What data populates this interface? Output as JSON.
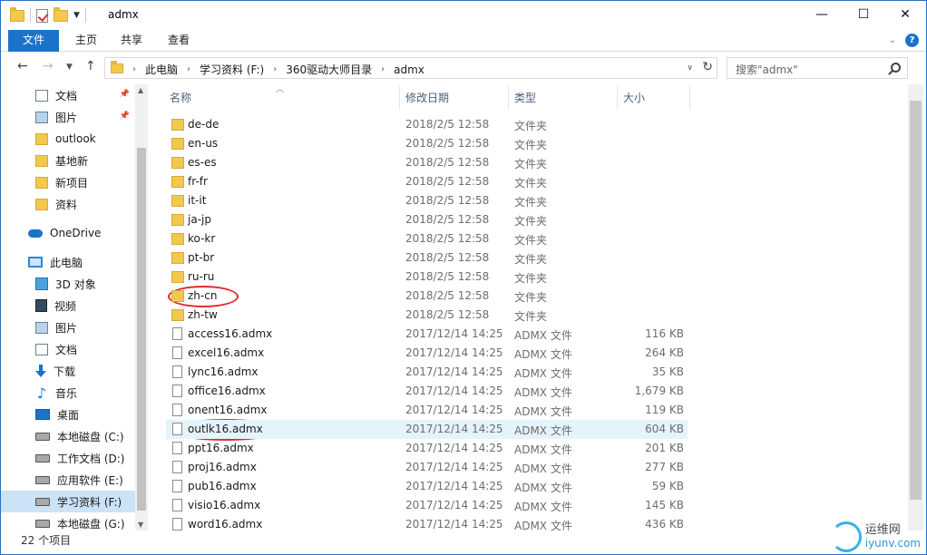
{
  "window": {
    "title": "admx"
  },
  "ribbon": {
    "tabs": [
      "文件",
      "主页",
      "共享",
      "查看"
    ]
  },
  "address": {
    "crumbs": [
      "此电脑",
      "学习资料 (F:)",
      "360驱动大师目录",
      "admx"
    ]
  },
  "search": {
    "placeholder": "搜索\"admx\""
  },
  "navpane": {
    "items": [
      {
        "label": "文档",
        "icon": "document-icon",
        "pinned": true
      },
      {
        "label": "图片",
        "icon": "picture-icon",
        "pinned": true
      },
      {
        "label": "outlook",
        "icon": "folder-icon"
      },
      {
        "label": "基地新",
        "icon": "folder-icon"
      },
      {
        "label": "新项目",
        "icon": "folder-icon"
      },
      {
        "label": "资料",
        "icon": "folder-icon"
      },
      {
        "label": "OneDrive",
        "icon": "onedrive-cloud-icon"
      },
      {
        "label": "此电脑",
        "icon": "this-pc-icon"
      },
      {
        "label": "3D 对象",
        "icon": "3d-objects-icon"
      },
      {
        "label": "视频",
        "icon": "video-icon"
      },
      {
        "label": "图片",
        "icon": "picture-icon"
      },
      {
        "label": "文档",
        "icon": "document-icon"
      },
      {
        "label": "下载",
        "icon": "download-icon"
      },
      {
        "label": "音乐",
        "icon": "music-icon"
      },
      {
        "label": "桌面",
        "icon": "desktop-icon"
      },
      {
        "label": "本地磁盘 (C:)",
        "icon": "drive-icon"
      },
      {
        "label": "工作文档 (D:)",
        "icon": "drive-icon"
      },
      {
        "label": "应用软件 (E:)",
        "icon": "drive-icon"
      },
      {
        "label": "学习资料 (F:)",
        "icon": "drive-icon",
        "selected": true
      },
      {
        "label": "本地磁盘 (G:)",
        "icon": "drive-icon"
      }
    ]
  },
  "columns": {
    "name": "名称",
    "date": "修改日期",
    "type": "类型",
    "size": "大小"
  },
  "files": [
    {
      "name": "de-de",
      "date": "2018/2/5 12:58",
      "type": "文件夹",
      "size": "",
      "kind": "folder"
    },
    {
      "name": "en-us",
      "date": "2018/2/5 12:58",
      "type": "文件夹",
      "size": "",
      "kind": "folder"
    },
    {
      "name": "es-es",
      "date": "2018/2/5 12:58",
      "type": "文件夹",
      "size": "",
      "kind": "folder"
    },
    {
      "name": "fr-fr",
      "date": "2018/2/5 12:58",
      "type": "文件夹",
      "size": "",
      "kind": "folder"
    },
    {
      "name": "it-it",
      "date": "2018/2/5 12:58",
      "type": "文件夹",
      "size": "",
      "kind": "folder"
    },
    {
      "name": "ja-jp",
      "date": "2018/2/5 12:58",
      "type": "文件夹",
      "size": "",
      "kind": "folder"
    },
    {
      "name": "ko-kr",
      "date": "2018/2/5 12:58",
      "type": "文件夹",
      "size": "",
      "kind": "folder"
    },
    {
      "name": "pt-br",
      "date": "2018/2/5 12:58",
      "type": "文件夹",
      "size": "",
      "kind": "folder"
    },
    {
      "name": "ru-ru",
      "date": "2018/2/5 12:58",
      "type": "文件夹",
      "size": "",
      "kind": "folder"
    },
    {
      "name": "zh-cn",
      "date": "2018/2/5 12:58",
      "type": "文件夹",
      "size": "",
      "kind": "folder"
    },
    {
      "name": "zh-tw",
      "date": "2018/2/5 12:58",
      "type": "文件夹",
      "size": "",
      "kind": "folder"
    },
    {
      "name": "access16.admx",
      "date": "2017/12/14 14:25",
      "type": "ADMX 文件",
      "size": "116 KB",
      "kind": "file"
    },
    {
      "name": "excel16.admx",
      "date": "2017/12/14 14:25",
      "type": "ADMX 文件",
      "size": "264 KB",
      "kind": "file"
    },
    {
      "name": "lync16.admx",
      "date": "2017/12/14 14:25",
      "type": "ADMX 文件",
      "size": "35 KB",
      "kind": "file"
    },
    {
      "name": "office16.admx",
      "date": "2017/12/14 14:25",
      "type": "ADMX 文件",
      "size": "1,679 KB",
      "kind": "file"
    },
    {
      "name": "onent16.admx",
      "date": "2017/12/14 14:25",
      "type": "ADMX 文件",
      "size": "119 KB",
      "kind": "file"
    },
    {
      "name": "outlk16.admx",
      "date": "2017/12/14 14:25",
      "type": "ADMX 文件",
      "size": "604 KB",
      "kind": "file",
      "hover": true
    },
    {
      "name": "ppt16.admx",
      "date": "2017/12/14 14:25",
      "type": "ADMX 文件",
      "size": "201 KB",
      "kind": "file"
    },
    {
      "name": "proj16.admx",
      "date": "2017/12/14 14:25",
      "type": "ADMX 文件",
      "size": "277 KB",
      "kind": "file"
    },
    {
      "name": "pub16.admx",
      "date": "2017/12/14 14:25",
      "type": "ADMX 文件",
      "size": "59 KB",
      "kind": "file"
    },
    {
      "name": "visio16.admx",
      "date": "2017/12/14 14:25",
      "type": "ADMX 文件",
      "size": "145 KB",
      "kind": "file"
    },
    {
      "name": "word16.admx",
      "date": "2017/12/14 14:25",
      "type": "ADMX 文件",
      "size": "436 KB",
      "kind": "file"
    }
  ],
  "status": {
    "count": "22 个项目"
  },
  "watermark": {
    "text": "运维网",
    "sub": "iyunv.com"
  },
  "colors": {
    "accent": "#1a73c8",
    "annotation": "#e02a2a",
    "selection": "#cce3f7"
  }
}
